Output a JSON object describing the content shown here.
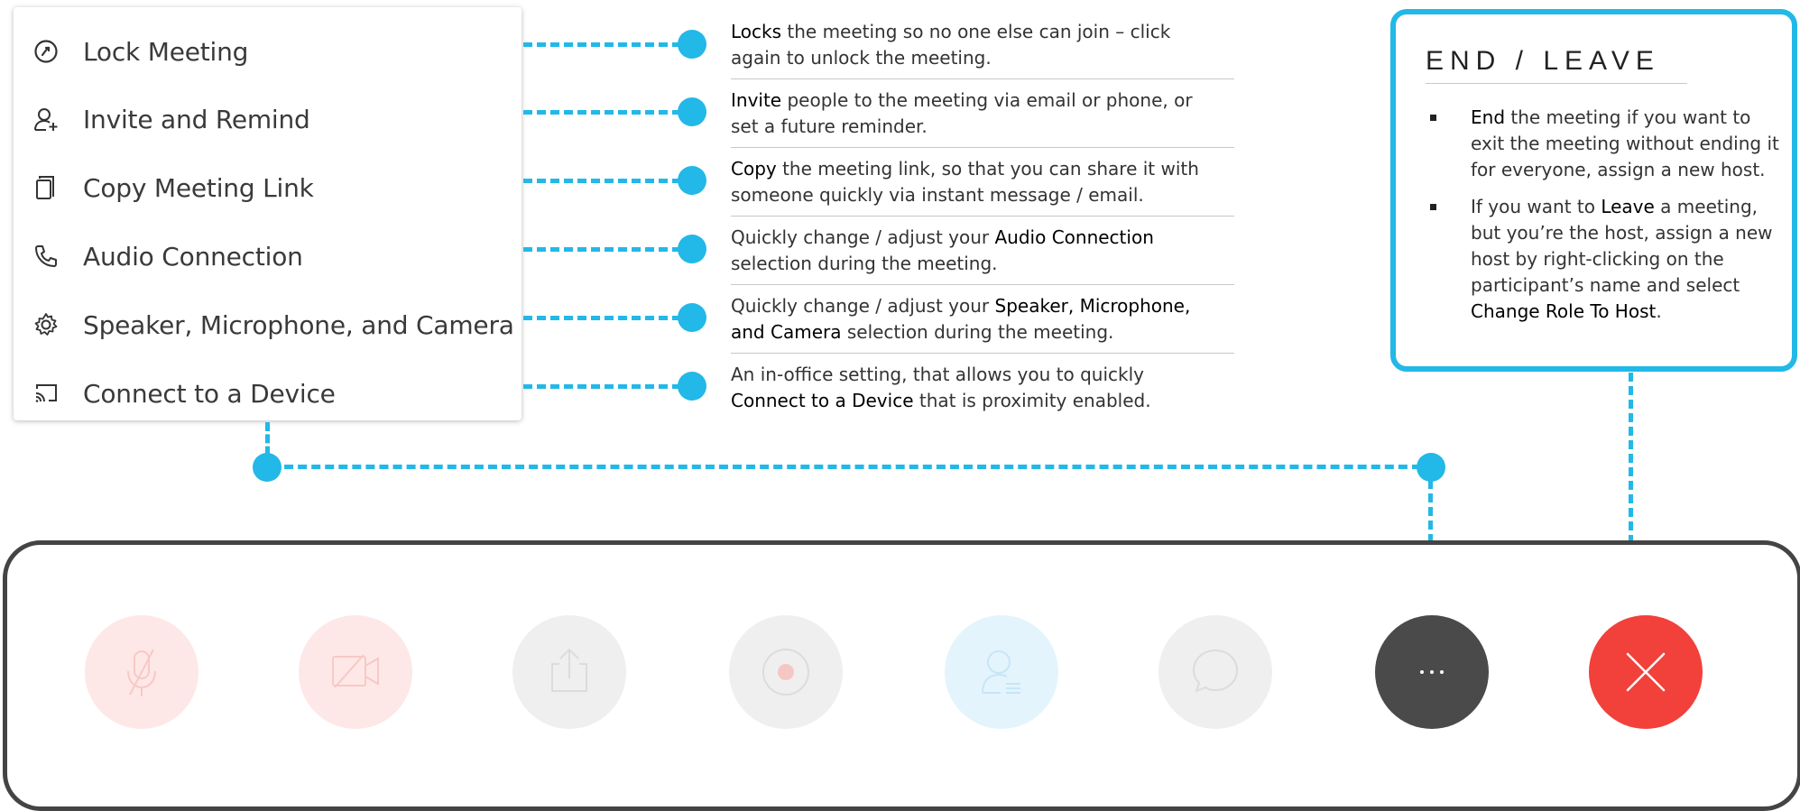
{
  "menu": {
    "items": [
      {
        "label": "Lock Meeting",
        "icon": "lock-icon"
      },
      {
        "label": "Invite and Remind",
        "icon": "add-person-icon"
      },
      {
        "label": "Copy Meeting Link",
        "icon": "copy-icon"
      },
      {
        "label": "Audio Connection",
        "icon": "phone-icon"
      },
      {
        "label": "Speaker, Microphone, and Camera",
        "icon": "gear-icon"
      },
      {
        "label": "Connect to a Device",
        "icon": "cast-icon"
      }
    ]
  },
  "descriptions": [
    {
      "pre": "",
      "bold": "Locks",
      "post": " the meeting so no one else can join – click again to unlock the meeting."
    },
    {
      "pre": "",
      "bold": "Invite",
      "post": " people to the meeting via email or phone, or set a future reminder."
    },
    {
      "pre": "",
      "bold": "Copy",
      "post": " the meeting link, so that you can share it with someone quickly via instant message / email."
    },
    {
      "pre": "Quickly change / adjust your ",
      "bold": "Audio Connection",
      "post": " selection during the meeting."
    },
    {
      "pre": "Quickly change / adjust your ",
      "bold": "Speaker, Microphone, and Camera",
      "post": " selection during the meeting."
    },
    {
      "pre": "An in-office setting, that allows you to quickly ",
      "bold": "Connect to a Device",
      "post": " that is proximity enabled."
    }
  ],
  "end_leave": {
    "title": "END / LEAVE",
    "bullet1": {
      "bold": "End",
      "post": " the meeting if you want to exit the meeting without ending it for everyone, assign a new host."
    },
    "bullet2": {
      "pre": "If you want to ",
      "bold1": "Leave",
      "mid": " a meeting, but you’re the host, assign a new host by right-clicking on the participant’s name and select ",
      "bold2": "Change Role To Host",
      "post": "."
    }
  },
  "toolbar": {
    "buttons": [
      {
        "icon": "microphone-muted-icon"
      },
      {
        "icon": "video-off-icon"
      },
      {
        "icon": "share-icon"
      },
      {
        "icon": "record-icon"
      },
      {
        "icon": "participants-icon"
      },
      {
        "icon": "chat-icon"
      },
      {
        "icon": "more-options-icon",
        "label": "···"
      },
      {
        "icon": "close-icon"
      }
    ]
  },
  "colors": {
    "accent": "#22b8e8",
    "end_red": "#f2403a",
    "more_dark": "#4a4a4a",
    "faded_red": "#fde8e7",
    "faded_gray": "#efefef",
    "faded_blue": "#e4f4fc"
  }
}
